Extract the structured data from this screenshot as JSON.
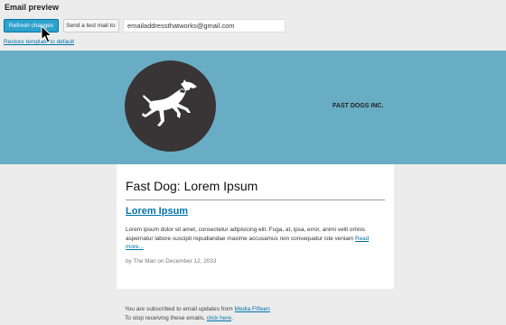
{
  "toolbar": {
    "title": "Email preview",
    "refresh_label": "Refresh changes",
    "send_label": "Send a test mail to:",
    "email_value": "emailaddressthatworks@gmail.com",
    "restore_label": "Restore template to default"
  },
  "email": {
    "header_color": "#69adc4",
    "company": "FAST DOGS INC.",
    "heading": "Fast Dog: Lorem Ipsum",
    "post_title": "Lorem Ipsum",
    "excerpt": "Lorem ipsum dolor sit amet, consectetur adipisicing elit. Fuga, at, ipsa, error, animi velit omnis aspernatur labore suscipit repudiandae maxime accusamus non consequatur iste veniam",
    "read_more": "Read more...",
    "byline": "by The Man on December 12, 2033",
    "footer": {
      "subscribed_text": "You are subscribed to email updates from",
      "site_link": "Media Fifteen",
      "stop_text": "To stop receiving these emails,",
      "unsubscribe_link": "click here",
      "end_punct": "."
    }
  }
}
